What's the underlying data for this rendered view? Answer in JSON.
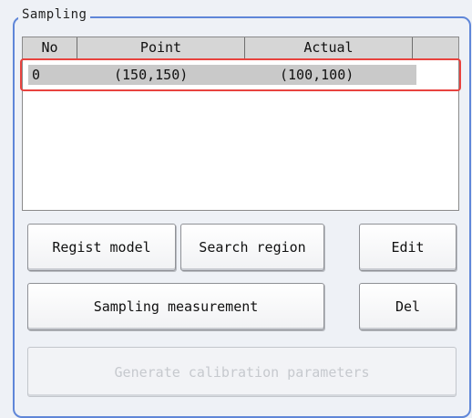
{
  "panel": {
    "legend": "Sampling"
  },
  "table": {
    "columns": [
      "No",
      "Point",
      "Actual"
    ],
    "rows": [
      {
        "no": "0",
        "point": "(150,150)",
        "actual": "(100,100)"
      }
    ]
  },
  "buttons": {
    "regist_model": "Regist model",
    "search_region": "Search region",
    "edit": "Edit",
    "sampling_measurement": "Sampling measurement",
    "del": "Del",
    "generate": "Generate calibration parameters"
  },
  "colors": {
    "panel_border": "#5f86d8",
    "selection_outline": "#e8433f",
    "header_bg": "#d6d6d6"
  }
}
